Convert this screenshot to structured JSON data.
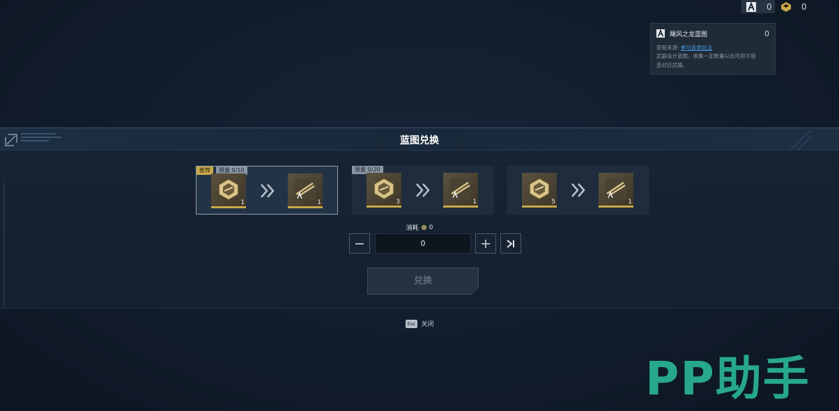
{
  "currencies": [
    {
      "icon": "blueprint-icon",
      "value": "0"
    },
    {
      "icon": "gold-shard-icon",
      "value": "0"
    }
  ],
  "tooltip": {
    "name": "飓风之龙蓝图",
    "count": "0",
    "source_label": "获取来源:",
    "source_link": "参与各类玩法",
    "desc_line1": "武器设计蓝图，收集一定数量以后可用于制",
    "desc_line2": "造对应武器。"
  },
  "panel": {
    "title": "蓝图兑换"
  },
  "offers": [
    {
      "recommended": "推荐",
      "limit": "限量 0/10",
      "cost_qty": "1",
      "reward_qty": "1"
    },
    {
      "recommended": "",
      "limit": "限量 0/20",
      "cost_qty": "3",
      "reward_qty": "1"
    },
    {
      "recommended": "",
      "limit": "",
      "cost_qty": "5",
      "reward_qty": "1"
    }
  ],
  "cost": {
    "label": "消耗",
    "value": "0"
  },
  "quantity": "0",
  "exchange_label": "兑换",
  "close": {
    "key": "Esc",
    "label": "关闭"
  },
  "watermark": "PP助手",
  "colors": {
    "gold": "#c9a94a",
    "link": "#4a9be8",
    "watermark": "#27a88d"
  }
}
